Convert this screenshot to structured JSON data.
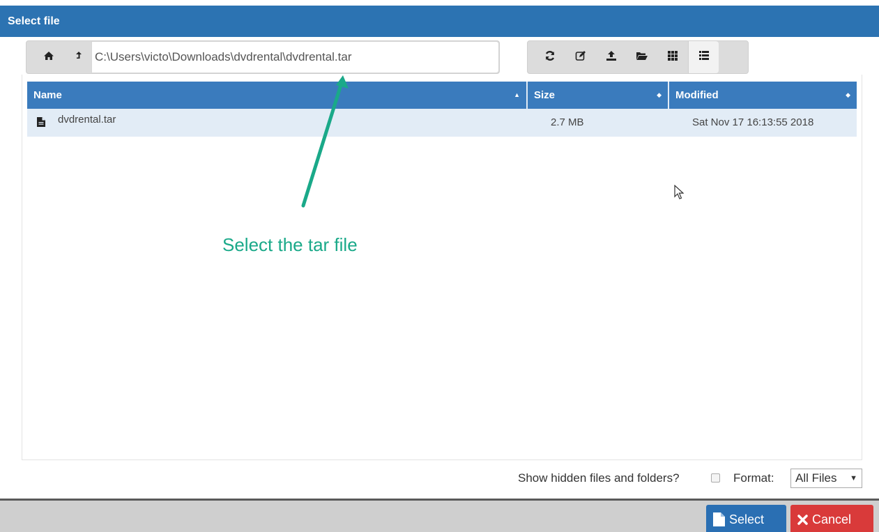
{
  "dialog": {
    "title": "Select file"
  },
  "pathbar": {
    "home_icon": "home-icon",
    "up_icon": "level-up-icon",
    "path_value": "C:\\Users\\victo\\Downloads\\dvdrental\\dvdrental.tar"
  },
  "toolbar": {
    "buttons": [
      {
        "icon": "refresh-icon"
      },
      {
        "icon": "rename-icon"
      },
      {
        "icon": "upload-icon"
      },
      {
        "icon": "new-folder-icon"
      },
      {
        "icon": "grid-view-icon"
      },
      {
        "icon": "list-view-icon",
        "active": true
      }
    ]
  },
  "table": {
    "columns": [
      {
        "label": "Name"
      },
      {
        "label": "Size"
      },
      {
        "label": "Modified"
      }
    ],
    "rows": [
      {
        "icon": "file-icon",
        "name": "dvdrental.tar",
        "size": "2.7 MB",
        "modified": "Sat Nov 17 16:13:55 2018"
      }
    ]
  },
  "annotation": {
    "text": "Select the tar file",
    "color": "#1aa989"
  },
  "options": {
    "show_hidden_label": "Show hidden files and folders?",
    "show_hidden_checked": false,
    "format_label": "Format:",
    "format_value": "All Files"
  },
  "footer": {
    "select_label": "Select",
    "cancel_label": "Cancel"
  },
  "colors": {
    "titlebar": "#2c73b2",
    "header": "#3a7bbd",
    "row_selected": "#e2ecf6",
    "select_button": "#2a6fb3",
    "cancel_button": "#d93a3a"
  }
}
